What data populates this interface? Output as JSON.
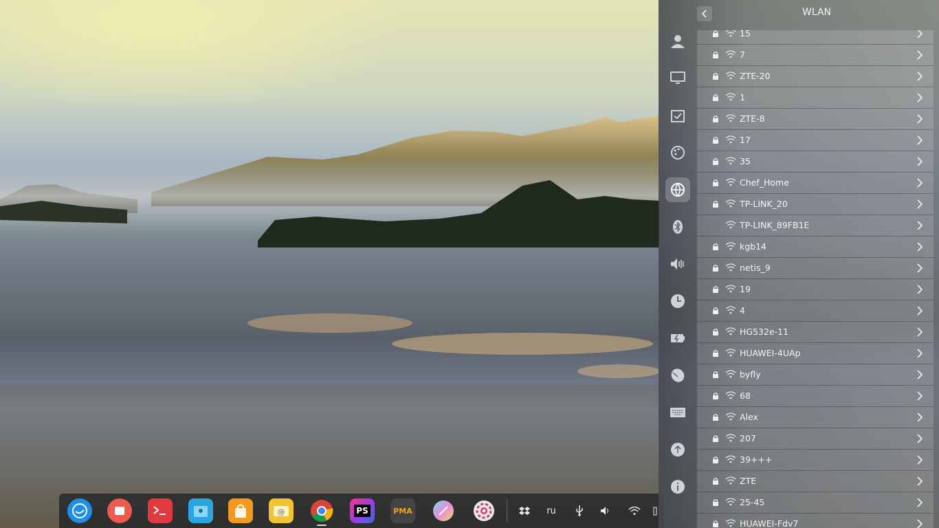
{
  "panel": {
    "title": "WLAN",
    "back_icon": "chevron-left-icon"
  },
  "nav_rail": [
    {
      "name": "accounts",
      "icon": "user-icon"
    },
    {
      "name": "display",
      "icon": "monitor-icon"
    },
    {
      "name": "default-applications",
      "icon": "calendar-check-icon"
    },
    {
      "name": "personalization",
      "icon": "palette-icon"
    },
    {
      "name": "network",
      "icon": "globe-network-icon",
      "active": true
    },
    {
      "name": "bluetooth",
      "icon": "bluetooth-icon"
    },
    {
      "name": "sound",
      "icon": "speaker-icon"
    },
    {
      "name": "time-date",
      "icon": "clock-icon"
    },
    {
      "name": "power",
      "icon": "battery-charge-icon"
    },
    {
      "name": "mouse",
      "icon": "mouse-icon"
    },
    {
      "name": "keyboard",
      "icon": "keyboard-icon"
    },
    {
      "name": "update",
      "icon": "arrow-up-icon"
    },
    {
      "name": "system-info",
      "icon": "info-icon"
    }
  ],
  "networks": [
    {
      "ssid": "15",
      "secured": true
    },
    {
      "ssid": "7",
      "secured": true
    },
    {
      "ssid": "ZTE-20",
      "secured": true
    },
    {
      "ssid": "1",
      "secured": true
    },
    {
      "ssid": "ZTE-8",
      "secured": true
    },
    {
      "ssid": "17",
      "secured": true
    },
    {
      "ssid": "35",
      "secured": true
    },
    {
      "ssid": "Chef_Home",
      "secured": true
    },
    {
      "ssid": "TP-LINK_20",
      "secured": true
    },
    {
      "ssid": "TP-LINK_89FB1E",
      "secured": false
    },
    {
      "ssid": "kgb14",
      "secured": true
    },
    {
      "ssid": "netis_9",
      "secured": true
    },
    {
      "ssid": "19",
      "secured": true
    },
    {
      "ssid": "4",
      "secured": true
    },
    {
      "ssid": "HG532e-11",
      "secured": true
    },
    {
      "ssid": "HUAWEI-4UAp",
      "secured": true
    },
    {
      "ssid": "byfly",
      "secured": true
    },
    {
      "ssid": "68",
      "secured": true
    },
    {
      "ssid": "Alex",
      "secured": true
    },
    {
      "ssid": "207",
      "secured": true
    },
    {
      "ssid": "39+++",
      "secured": true
    },
    {
      "ssid": "ZTE",
      "secured": true
    },
    {
      "ssid": "25-45",
      "secured": true
    },
    {
      "ssid": "HUAWEI-Fdv7",
      "secured": true
    }
  ],
  "dock": {
    "apps": [
      {
        "name": "launcher",
        "icon": "deepin-launcher-icon",
        "color": "#1e8ee8"
      },
      {
        "name": "multitasking",
        "icon": "multitask-view-icon",
        "color": "#ef5a4e"
      },
      {
        "name": "terminal",
        "icon": "terminal-icon",
        "color": "#e03a3e"
      },
      {
        "name": "file-manager",
        "icon": "folder-icon",
        "color": "#2aa7e0"
      },
      {
        "name": "app-store",
        "icon": "shopping-bag-icon",
        "color": "#f39a1e"
      },
      {
        "name": "mail",
        "icon": "mail-icon",
        "color": "#f1c232"
      },
      {
        "name": "chrome",
        "icon": "chrome-icon",
        "color": "#ffffff"
      },
      {
        "name": "phpstorm",
        "icon": "phpstorm-icon",
        "color": "#a33bdc",
        "label": "PS"
      },
      {
        "name": "phpmyadmin",
        "icon": "phpmyadmin-icon",
        "color": "#444444",
        "label": "PMA"
      },
      {
        "name": "color-picker",
        "icon": "color-wheel-icon",
        "color": "#d07ad8"
      },
      {
        "name": "control-center",
        "icon": "settings-gear-icon",
        "color": "#e8e8e8"
      }
    ],
    "tray": {
      "dropbox_icon": "dropbox-icon",
      "keyboard_layout": "ru",
      "usb_icon": "usb-icon",
      "volume_icon": "volume-icon",
      "wifi_icon": "wifi-icon"
    }
  }
}
